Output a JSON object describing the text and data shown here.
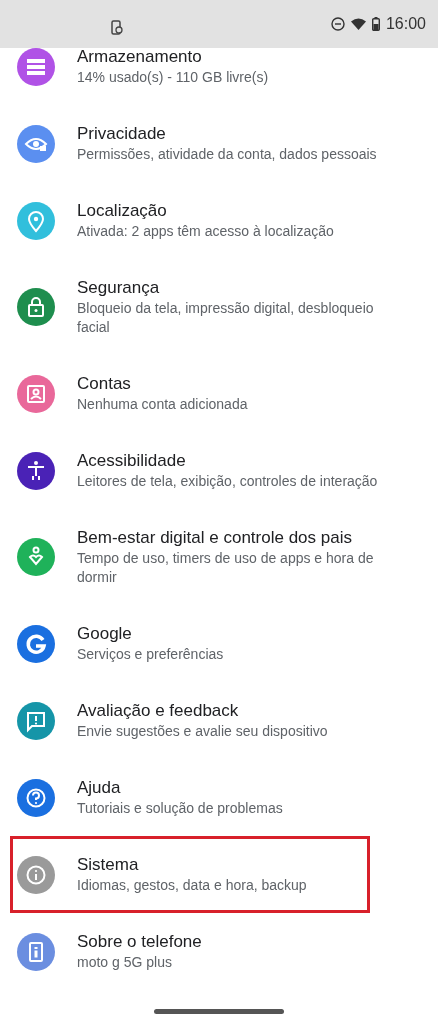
{
  "status_bar": {
    "time": "16:00"
  },
  "items": [
    {
      "title": "Armazenamento",
      "subtitle": "14% usado(s) - 110 GB livre(s)",
      "color": "#b052e6",
      "highlighted": false
    },
    {
      "title": "Privacidade",
      "subtitle": "Permissões, atividade da conta, dados pessoais",
      "color": "#5b8ff0",
      "highlighted": false
    },
    {
      "title": "Localização",
      "subtitle": "Ativada: 2 apps têm acesso à localização",
      "color": "#31bfdc",
      "highlighted": false
    },
    {
      "title": "Segurança",
      "subtitle": "Bloqueio da tela, impressão digital, desbloqueio facial",
      "color": "#1e8e4e",
      "highlighted": false
    },
    {
      "title": "Contas",
      "subtitle": "Nenhuma conta adicionada",
      "color": "#e9689a",
      "highlighted": false
    },
    {
      "title": "Acessibilidade",
      "subtitle": "Leitores de tela, exibição, controles de interação",
      "color": "#4a22b6",
      "highlighted": false
    },
    {
      "title": "Bem-estar digital e controle dos pais",
      "subtitle": "Tempo de uso, timers de uso de apps e hora de dormir",
      "color": "#1fb25a",
      "highlighted": false
    },
    {
      "title": "Google",
      "subtitle": "Serviços e preferências",
      "color": "#1a6fe0",
      "highlighted": false
    },
    {
      "title": "Avaliação e feedback",
      "subtitle": "Envie sugestões e avalie seu dispositivo",
      "color": "#1595a8",
      "highlighted": false
    },
    {
      "title": "Ajuda",
      "subtitle": "Tutoriais e solução de problemas",
      "color": "#1a6fe0",
      "highlighted": false
    },
    {
      "title": "Sistema",
      "subtitle": "Idiomas, gestos, data e hora, backup",
      "color": "#9a9a9a",
      "highlighted": true
    },
    {
      "title": "Sobre o telefone",
      "subtitle": "moto g 5G plus",
      "color": "#6b8ee0",
      "highlighted": false
    }
  ]
}
